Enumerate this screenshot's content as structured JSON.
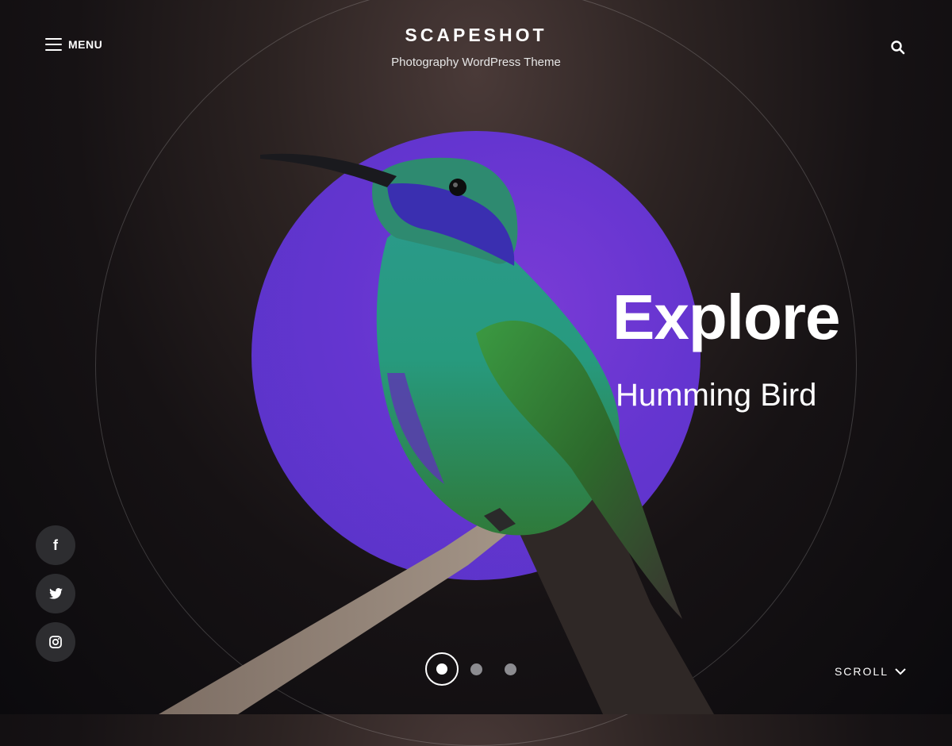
{
  "header": {
    "menu_label": "MENU",
    "site_title": "SCAPESHOT",
    "tagline": "Photography WordPress Theme",
    "search_icon": "search-icon"
  },
  "hero": {
    "title": "Explore",
    "subtitle": "Humming Bird",
    "accent_color": "#6535d0"
  },
  "social": [
    {
      "name": "facebook",
      "icon": "facebook-icon",
      "glyph": "f"
    },
    {
      "name": "twitter",
      "icon": "twitter-icon"
    },
    {
      "name": "instagram",
      "icon": "instagram-icon"
    }
  ],
  "slider": {
    "slide_count": 3,
    "active_index": 0
  },
  "scroll": {
    "label": "SCROLL"
  }
}
